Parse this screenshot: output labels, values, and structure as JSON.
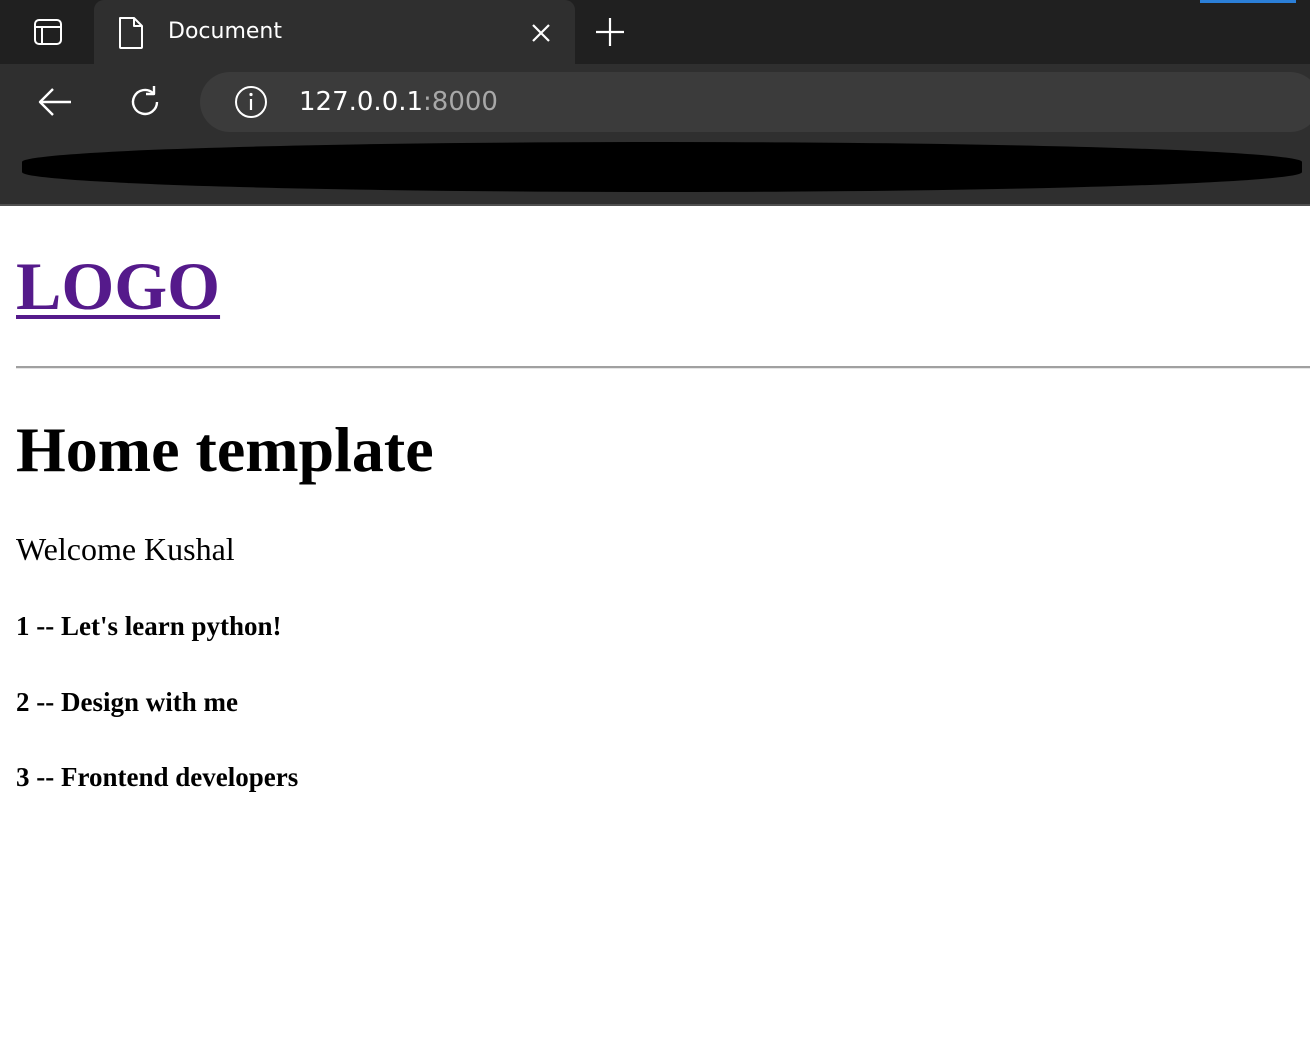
{
  "browser": {
    "tab": {
      "title": "Document"
    },
    "address_bar": {
      "host": "127.0.0.1",
      "port": ":8000"
    },
    "icons": {
      "tab_actions": "tab-actions-icon",
      "favicon": "page-icon",
      "close": "close-icon",
      "new_tab": "plus-icon",
      "back": "back-arrow-icon",
      "reload": "reload-icon",
      "site_info": "info-icon"
    },
    "colors": {
      "tabstrip": "#202020",
      "toolbar": "#2f2f2f",
      "address_bar": "#3b3b3b",
      "accent": "#2b7fd8"
    }
  },
  "page": {
    "logo": "LOGO",
    "heading": "Home template",
    "welcome": "Welcome Kushal",
    "courses": [
      "1 -- Let's learn python!",
      "2 -- Design with me",
      "3 -- Frontend developers"
    ],
    "colors": {
      "visited_link": "#551a8b",
      "text": "#000000"
    }
  }
}
